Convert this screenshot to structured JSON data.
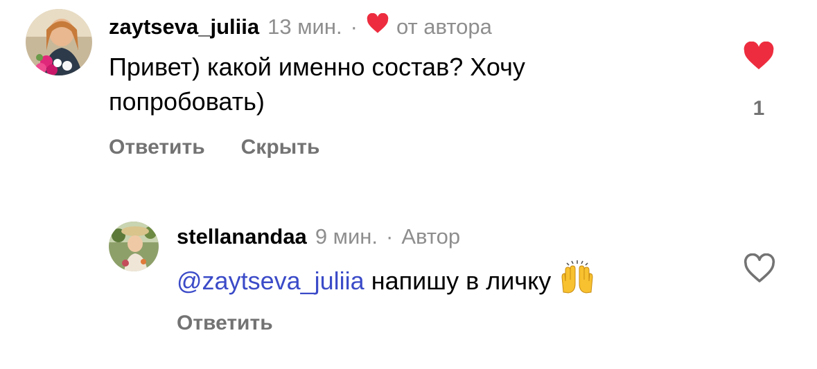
{
  "comments": [
    {
      "username": "zaytseva_juliia",
      "time": "13 мин.",
      "separator": "·",
      "author_like_label": "от автора",
      "text": "Привет) какой именно состав? Хочу попробовать)",
      "reply_label": "Ответить",
      "hide_label": "Скрыть",
      "like_count": "1",
      "liked": true
    },
    {
      "username": "stellanandaa",
      "time": "9 мин.",
      "separator": "·",
      "author_badge": "Автор",
      "mention": "@zaytseva_juliia",
      "text": "напишу в личку",
      "emoji": "raising-hands-emoji",
      "reply_label": "Ответить",
      "liked": false
    }
  ],
  "colors": {
    "heart_red": "#ed2d3f",
    "mention_blue": "#3b4bc8",
    "muted_gray": "#8e8e8e",
    "action_gray": "#737373"
  }
}
